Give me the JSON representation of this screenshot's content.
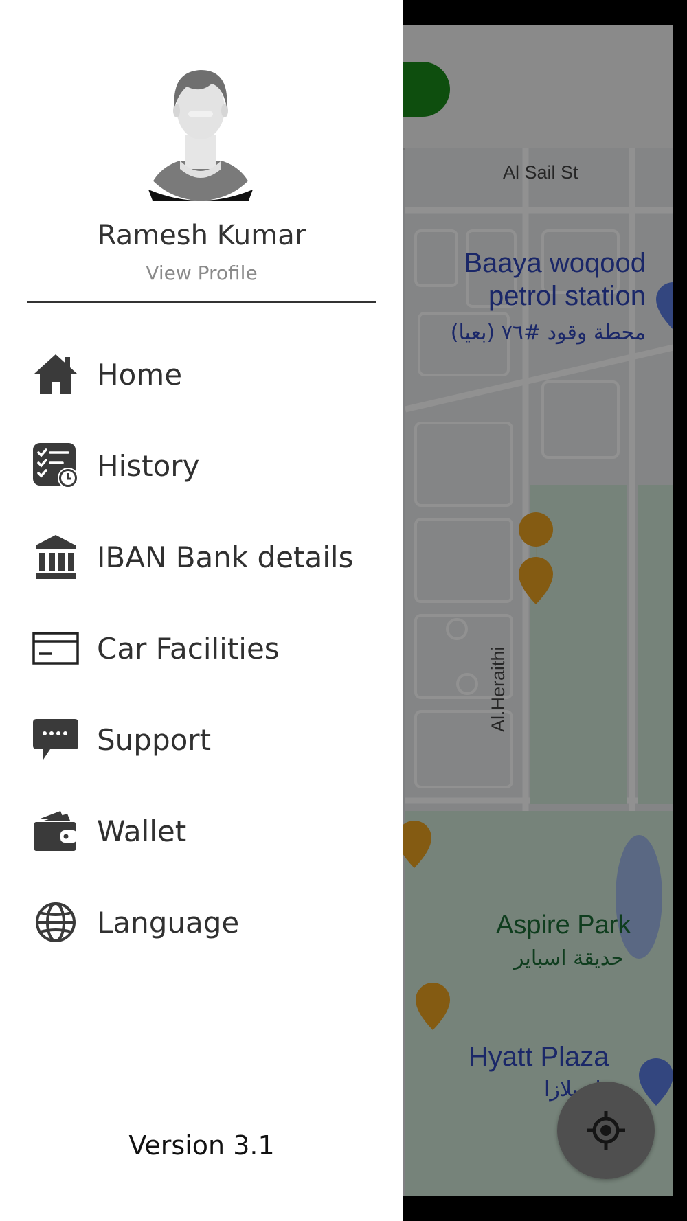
{
  "profile": {
    "name": "Ramesh Kumar",
    "view_profile_label": "View Profile"
  },
  "menu": {
    "items": [
      {
        "label": "Home",
        "icon": "home-icon"
      },
      {
        "label": "History",
        "icon": "history-checklist-icon"
      },
      {
        "label": "IBAN Bank details",
        "icon": "bank-icon"
      },
      {
        "label": "Car Facilities",
        "icon": "card-icon"
      },
      {
        "label": "Support",
        "icon": "chat-support-icon"
      },
      {
        "label": "Wallet",
        "icon": "wallet-icon"
      },
      {
        "label": "Language",
        "icon": "globe-icon"
      }
    ]
  },
  "version_label": "Version 3.1",
  "map": {
    "street_top": "Al Sail St",
    "poi_petrol_en_1": "Baaya woqood",
    "poi_petrol_en_2": "petrol station",
    "poi_petrol_ar": "محطة وقود #٧٦ (بعيا)",
    "street_vertical": "Al.Heraithi",
    "park_en": "Aspire Park",
    "park_ar": "حديقة اسباير",
    "plaza_en": "Hyatt Plaza",
    "plaza_ar": "حياة بلازا"
  },
  "colors": {
    "drawer_bg": "#ffffff",
    "scrim": "rgba(0,0,0,0.43)",
    "accent_green": "#1a8a1a",
    "park_green": "#cfe6d6",
    "poi_blue": "#2f45b8",
    "food_orange": "#e8a020"
  }
}
